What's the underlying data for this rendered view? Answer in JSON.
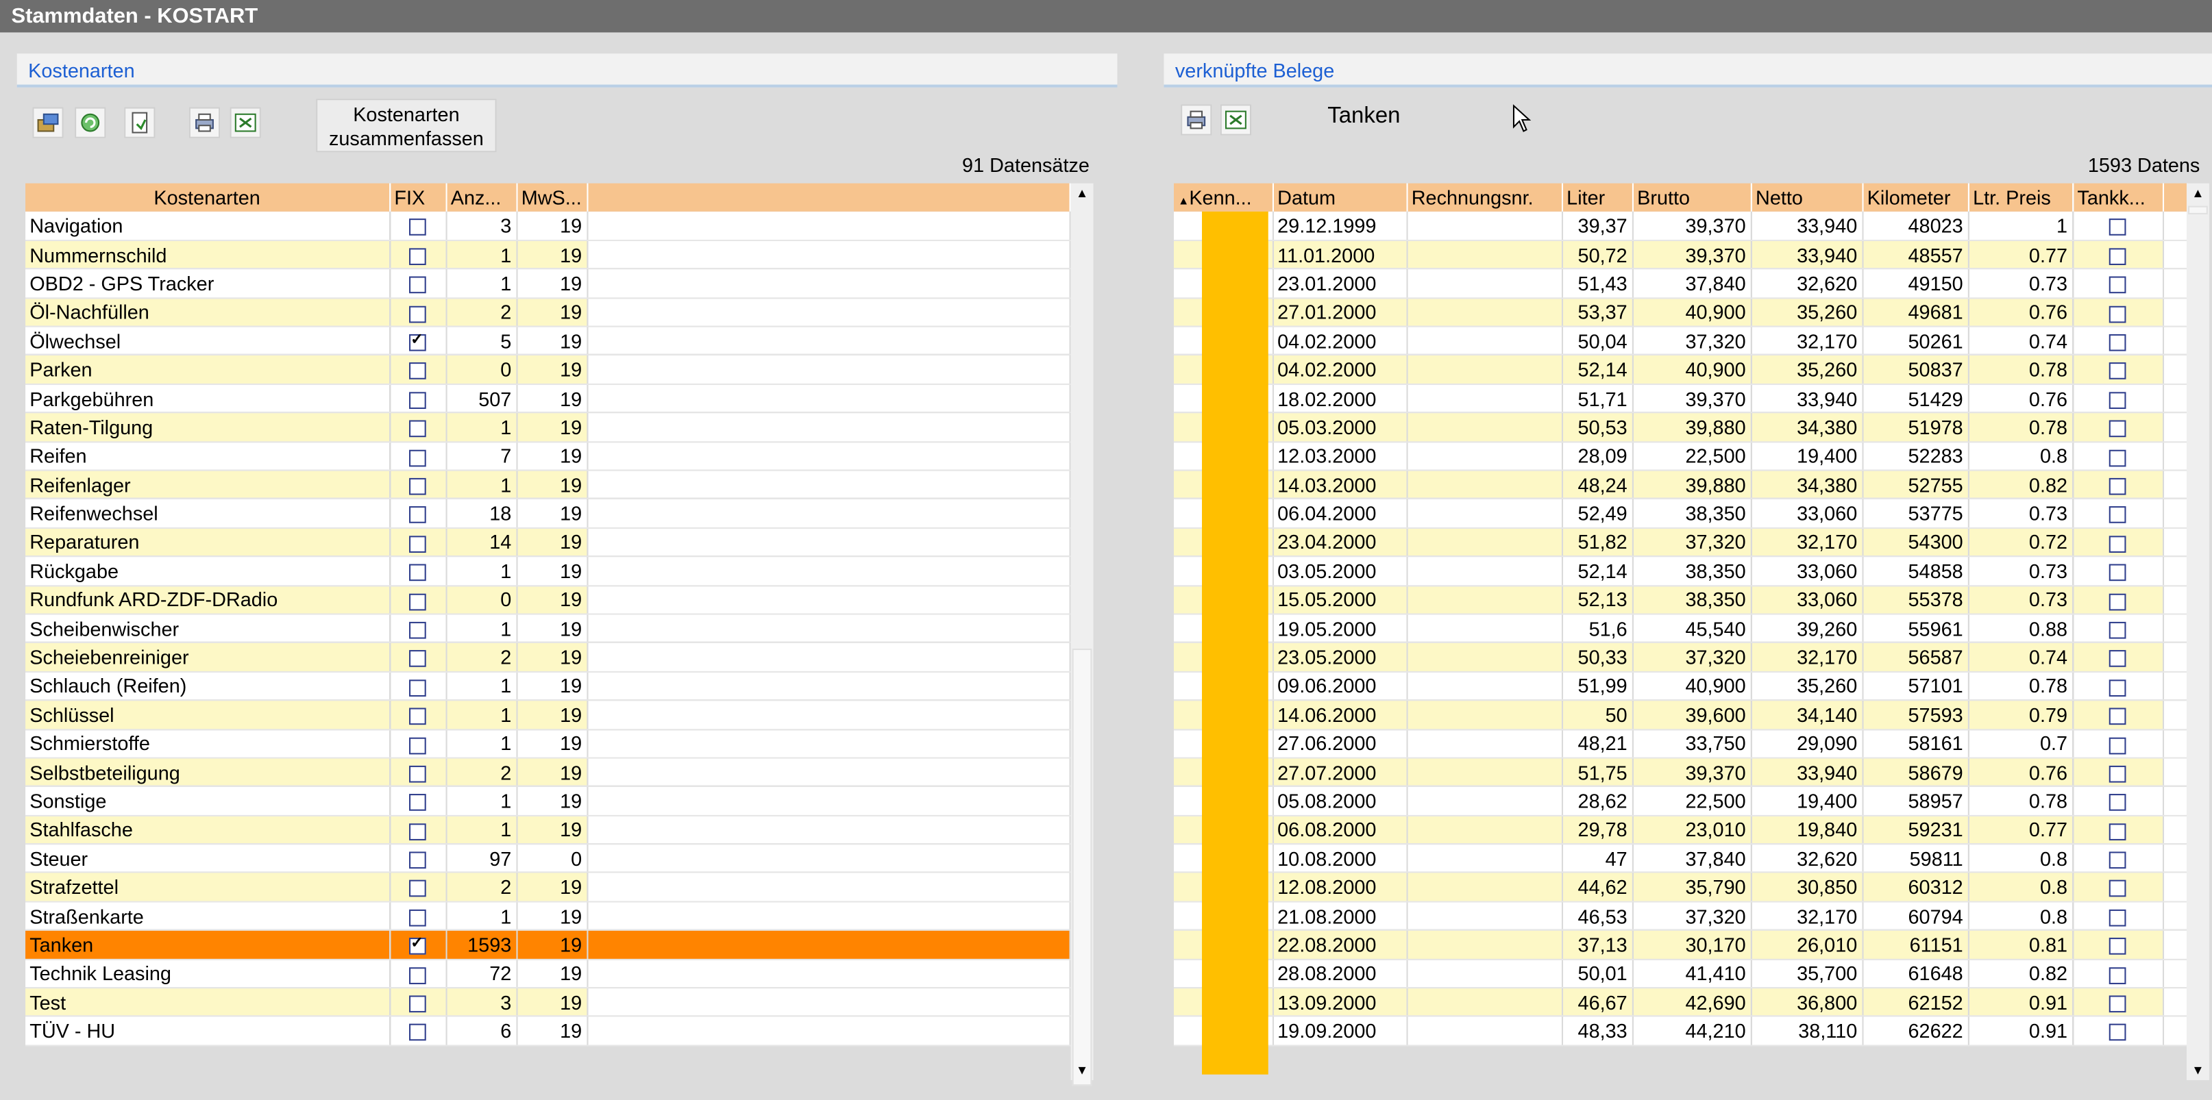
{
  "window": {
    "title": "Stammdaten - KOSTART"
  },
  "left": {
    "title": "Kostenarten",
    "merge_button": "Kostenarten\nzusammenfassen",
    "count": "91 Datensätze",
    "columns": [
      "Kostenarten",
      "FIX",
      "Anz...",
      "MwS..."
    ],
    "rows": [
      {
        "name": "Navigation",
        "fix": false,
        "anz": "3",
        "mws": "19"
      },
      {
        "name": "Nummernschild",
        "fix": false,
        "anz": "1",
        "mws": "19"
      },
      {
        "name": "OBD2 - GPS Tracker",
        "fix": false,
        "anz": "1",
        "mws": "19"
      },
      {
        "name": "Öl-Nachfüllen",
        "fix": false,
        "anz": "2",
        "mws": "19"
      },
      {
        "name": "Ölwechsel",
        "fix": true,
        "anz": "5",
        "mws": "19"
      },
      {
        "name": "Parken",
        "fix": false,
        "anz": "0",
        "mws": "19"
      },
      {
        "name": "Parkgebühren",
        "fix": false,
        "anz": "507",
        "mws": "19"
      },
      {
        "name": "Raten-Tilgung",
        "fix": false,
        "anz": "1",
        "mws": "19"
      },
      {
        "name": "Reifen",
        "fix": false,
        "anz": "7",
        "mws": "19"
      },
      {
        "name": "Reifenlager",
        "fix": false,
        "anz": "1",
        "mws": "19"
      },
      {
        "name": "Reifenwechsel",
        "fix": false,
        "anz": "18",
        "mws": "19"
      },
      {
        "name": "Reparaturen",
        "fix": false,
        "anz": "14",
        "mws": "19"
      },
      {
        "name": "Rückgabe",
        "fix": false,
        "anz": "1",
        "mws": "19"
      },
      {
        "name": "Rundfunk ARD-ZDF-DRadio",
        "fix": false,
        "anz": "0",
        "mws": "19"
      },
      {
        "name": "Scheibenwischer",
        "fix": false,
        "anz": "1",
        "mws": "19"
      },
      {
        "name": "Scheiebenreiniger",
        "fix": false,
        "anz": "2",
        "mws": "19"
      },
      {
        "name": "Schlauch (Reifen)",
        "fix": false,
        "anz": "1",
        "mws": "19"
      },
      {
        "name": "Schlüssel",
        "fix": false,
        "anz": "1",
        "mws": "19"
      },
      {
        "name": "Schmierstoffe",
        "fix": false,
        "anz": "1",
        "mws": "19"
      },
      {
        "name": "Selbstbeteiligung",
        "fix": false,
        "anz": "2",
        "mws": "19"
      },
      {
        "name": "Sonstige",
        "fix": false,
        "anz": "1",
        "mws": "19"
      },
      {
        "name": "Stahlfasche",
        "fix": false,
        "anz": "1",
        "mws": "19"
      },
      {
        "name": "Steuer",
        "fix": false,
        "anz": "97",
        "mws": "0"
      },
      {
        "name": "Strafzettel",
        "fix": false,
        "anz": "2",
        "mws": "19"
      },
      {
        "name": "Straßenkarte",
        "fix": false,
        "anz": "1",
        "mws": "19"
      },
      {
        "name": "Tanken",
        "fix": true,
        "anz": "1593",
        "mws": "19",
        "selected": true
      },
      {
        "name": "Technik Leasing",
        "fix": false,
        "anz": "72",
        "mws": "19"
      },
      {
        "name": "Test",
        "fix": false,
        "anz": "3",
        "mws": "19"
      },
      {
        "name": "TÜV - HU",
        "fix": false,
        "anz": "6",
        "mws": "19"
      }
    ]
  },
  "right": {
    "title": "verknüpfte Belege",
    "label": "Tanken",
    "count": "1593 Datens",
    "columns": [
      "Kenn...",
      "Datum",
      "Rechnungsnr.",
      "Liter",
      "Brutto",
      "Netto",
      "Kilometer",
      "Ltr. Preis",
      "Tankk..."
    ],
    "rows": [
      {
        "datum": "29.12.1999",
        "liter": "39,37",
        "brutto": "39,370",
        "netto": "33,940",
        "km": "48023",
        "preis": "1"
      },
      {
        "datum": "11.01.2000",
        "liter": "50,72",
        "brutto": "39,370",
        "netto": "33,940",
        "km": "48557",
        "preis": "0.77"
      },
      {
        "datum": "23.01.2000",
        "liter": "51,43",
        "brutto": "37,840",
        "netto": "32,620",
        "km": "49150",
        "preis": "0.73"
      },
      {
        "datum": "27.01.2000",
        "liter": "53,37",
        "brutto": "40,900",
        "netto": "35,260",
        "km": "49681",
        "preis": "0.76"
      },
      {
        "datum": "04.02.2000",
        "liter": "50,04",
        "brutto": "37,320",
        "netto": "32,170",
        "km": "50261",
        "preis": "0.74"
      },
      {
        "datum": "04.02.2000",
        "liter": "52,14",
        "brutto": "40,900",
        "netto": "35,260",
        "km": "50837",
        "preis": "0.78"
      },
      {
        "datum": "18.02.2000",
        "liter": "51,71",
        "brutto": "39,370",
        "netto": "33,940",
        "km": "51429",
        "preis": "0.76"
      },
      {
        "datum": "05.03.2000",
        "liter": "50,53",
        "brutto": "39,880",
        "netto": "34,380",
        "km": "51978",
        "preis": "0.78"
      },
      {
        "datum": "12.03.2000",
        "liter": "28,09",
        "brutto": "22,500",
        "netto": "19,400",
        "km": "52283",
        "preis": "0.8"
      },
      {
        "datum": "14.03.2000",
        "liter": "48,24",
        "brutto": "39,880",
        "netto": "34,380",
        "km": "52755",
        "preis": "0.82"
      },
      {
        "datum": "06.04.2000",
        "liter": "52,49",
        "brutto": "38,350",
        "netto": "33,060",
        "km": "53775",
        "preis": "0.73"
      },
      {
        "datum": "23.04.2000",
        "liter": "51,82",
        "brutto": "37,320",
        "netto": "32,170",
        "km": "54300",
        "preis": "0.72"
      },
      {
        "datum": "03.05.2000",
        "liter": "52,14",
        "brutto": "38,350",
        "netto": "33,060",
        "km": "54858",
        "preis": "0.73"
      },
      {
        "datum": "15.05.2000",
        "liter": "52,13",
        "brutto": "38,350",
        "netto": "33,060",
        "km": "55378",
        "preis": "0.73"
      },
      {
        "datum": "19.05.2000",
        "liter": "51,6",
        "brutto": "45,540",
        "netto": "39,260",
        "km": "55961",
        "preis": "0.88"
      },
      {
        "datum": "23.05.2000",
        "liter": "50,33",
        "brutto": "37,320",
        "netto": "32,170",
        "km": "56587",
        "preis": "0.74"
      },
      {
        "datum": "09.06.2000",
        "liter": "51,99",
        "brutto": "40,900",
        "netto": "35,260",
        "km": "57101",
        "preis": "0.78"
      },
      {
        "datum": "14.06.2000",
        "liter": "50",
        "brutto": "39,600",
        "netto": "34,140",
        "km": "57593",
        "preis": "0.79"
      },
      {
        "datum": "27.06.2000",
        "liter": "48,21",
        "brutto": "33,750",
        "netto": "29,090",
        "km": "58161",
        "preis": "0.7"
      },
      {
        "datum": "27.07.2000",
        "liter": "51,75",
        "brutto": "39,370",
        "netto": "33,940",
        "km": "58679",
        "preis": "0.76"
      },
      {
        "datum": "05.08.2000",
        "liter": "28,62",
        "brutto": "22,500",
        "netto": "19,400",
        "km": "58957",
        "preis": "0.78"
      },
      {
        "datum": "06.08.2000",
        "liter": "29,78",
        "brutto": "23,010",
        "netto": "19,840",
        "km": "59231",
        "preis": "0.77"
      },
      {
        "datum": "10.08.2000",
        "liter": "47",
        "brutto": "37,840",
        "netto": "32,620",
        "km": "59811",
        "preis": "0.8"
      },
      {
        "datum": "12.08.2000",
        "liter": "44,62",
        "brutto": "35,790",
        "netto": "30,850",
        "km": "60312",
        "preis": "0.8"
      },
      {
        "datum": "21.08.2000",
        "liter": "46,53",
        "brutto": "37,320",
        "netto": "32,170",
        "km": "60794",
        "preis": "0.8"
      },
      {
        "datum": "22.08.2000",
        "liter": "37,13",
        "brutto": "30,170",
        "netto": "26,010",
        "km": "61151",
        "preis": "0.81"
      },
      {
        "datum": "28.08.2000",
        "liter": "50,01",
        "brutto": "41,410",
        "netto": "35,700",
        "km": "61648",
        "preis": "0.82"
      },
      {
        "datum": "13.09.2000",
        "liter": "46,67",
        "brutto": "42,690",
        "netto": "36,800",
        "km": "62152",
        "preis": "0.91"
      },
      {
        "datum": "19.09.2000",
        "liter": "48,33",
        "brutto": "44,210",
        "netto": "38,110",
        "km": "62622",
        "preis": "0.91"
      }
    ]
  },
  "icons": {
    "left_toolbar": [
      "properties-icon",
      "refresh-icon",
      "export-icon",
      "print-icon",
      "excel-icon"
    ],
    "right_toolbar": [
      "print-icon",
      "excel-icon"
    ]
  },
  "colors": {
    "header": "#f7c48e",
    "row_alt": "#fdf8c6",
    "selected": "#ff8400",
    "redaction": "#ffbf00",
    "title_link": "#1c5fd3"
  }
}
